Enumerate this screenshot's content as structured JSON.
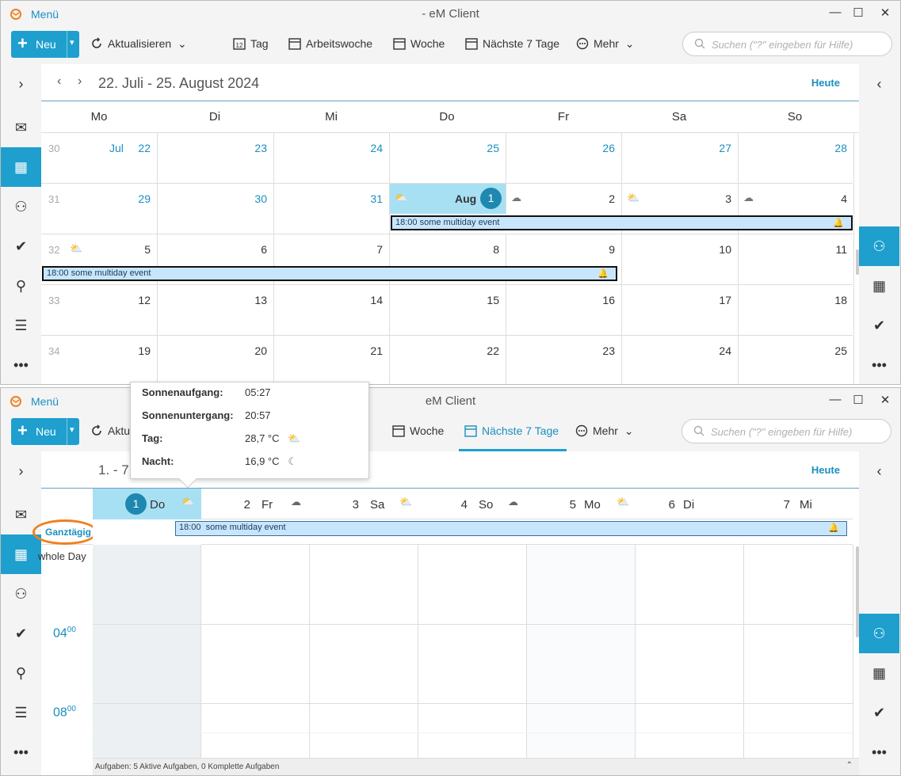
{
  "colors": {
    "accent": "#1e9fcd",
    "today": "#a8e0f3",
    "event": "#c8e6fb",
    "highlight": "#f08020"
  },
  "window1": {
    "menu_label": "Menü",
    "title": "- eM Client",
    "new_label": "Neu",
    "toolbar": {
      "refresh": "Aktualisieren",
      "day": "Tag",
      "workweek": "Arbeitswoche",
      "week": "Woche",
      "next7": "Nächste 7 Tage",
      "more": "Mehr"
    },
    "search_placeholder": "Suchen (\"?\" eingeben für Hilfe)",
    "range": "22. Juli - 25. August 2024",
    "today_btn": "Heute",
    "weekdays": [
      "Mo",
      "Di",
      "Mi",
      "Do",
      "Fr",
      "Sa",
      "So"
    ],
    "weeks": [
      {
        "num": "30",
        "days": [
          "22",
          "23",
          "24",
          "25",
          "26",
          "27",
          "28"
        ],
        "month_label": "Jul"
      },
      {
        "num": "31",
        "days": [
          "29",
          "30",
          "31",
          "1",
          "2",
          "3",
          "4"
        ],
        "month_label": "Aug"
      },
      {
        "num": "32",
        "days": [
          "5",
          "6",
          "7",
          "8",
          "9",
          "10",
          "11"
        ]
      },
      {
        "num": "33",
        "days": [
          "12",
          "13",
          "14",
          "15",
          "16",
          "17",
          "18"
        ]
      },
      {
        "num": "34",
        "days": [
          "19",
          "20",
          "21",
          "22",
          "23",
          "24",
          "25"
        ]
      }
    ],
    "event1": {
      "time": "18:00",
      "title": "some multiday event"
    },
    "event2": {
      "time": "18:00",
      "title": "some multiday event"
    }
  },
  "window2": {
    "menu_label": "Menü",
    "title": "eM Client",
    "new_label": "Neu",
    "toolbar": {
      "refresh": "Aktu",
      "week": "Woche",
      "next7": "Nächste 7 Tage",
      "more": "Mehr"
    },
    "search_placeholder": "Suchen (\"?\" eingeben für Hilfe)",
    "range": "1. - 7",
    "today_btn": "Heute",
    "days": [
      {
        "n": "1",
        "w": "Do"
      },
      {
        "n": "2",
        "w": "Fr"
      },
      {
        "n": "3",
        "w": "Sa"
      },
      {
        "n": "4",
        "w": "So"
      },
      {
        "n": "5",
        "w": "Mo"
      },
      {
        "n": "6",
        "w": "Di"
      },
      {
        "n": "7",
        "w": "Mi"
      }
    ],
    "allday_label": "Ganztägig",
    "wholeday_label": "whole Day",
    "event": {
      "time": "18:00",
      "title": "some multiday event"
    },
    "hours": [
      {
        "h": "04",
        "m": "00"
      },
      {
        "h": "08",
        "m": "00"
      }
    ],
    "status": "Aufgaben: 5 Aktive Aufgaben, 0 Komplette Aufgaben"
  },
  "popup": {
    "sunrise_label": "Sonnenaufgang:",
    "sunrise": "05:27",
    "sunset_label": "Sonnenuntergang:",
    "sunset": "20:57",
    "day_label": "Tag:",
    "day": "28,7 °C",
    "night_label": "Nacht:",
    "night": "16,9 °C"
  }
}
